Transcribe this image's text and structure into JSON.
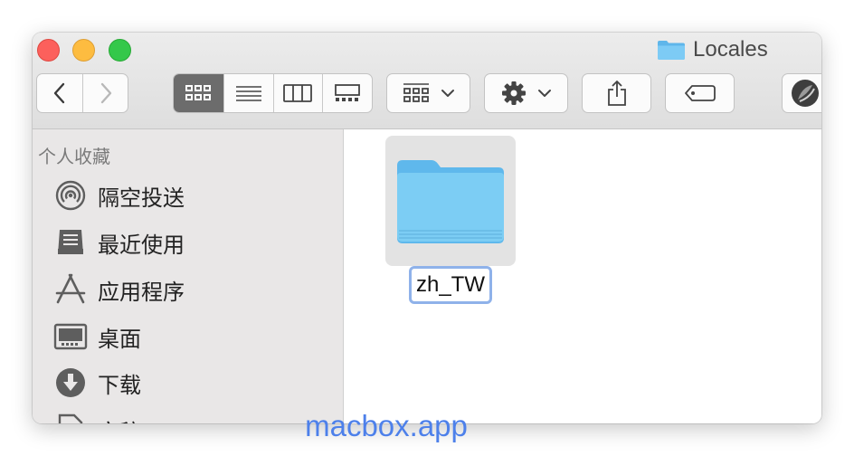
{
  "window": {
    "title": "Locales",
    "title_icon": "folder-icon"
  },
  "toolbar": {
    "back_icon": "chevron-left-icon",
    "forward_icon": "chevron-right-icon",
    "views": [
      "icon-view",
      "list-view",
      "column-view",
      "gallery-view"
    ],
    "active_view": "icon-view",
    "group_icon": "group-grid-icon",
    "action_icon": "gear-icon",
    "share_icon": "share-icon",
    "tags_icon": "tag-icon",
    "extension_icon": "app-extension-icon"
  },
  "sidebar": {
    "heading": "个人收藏",
    "items": [
      {
        "label": "隔空投送",
        "icon": "airdrop-icon"
      },
      {
        "label": "最近使用",
        "icon": "recents-icon"
      },
      {
        "label": "应用程序",
        "icon": "applications-icon"
      },
      {
        "label": "桌面",
        "icon": "desktop-icon"
      },
      {
        "label": "下载",
        "icon": "downloads-icon"
      },
      {
        "label": "文稿",
        "icon": "documents-icon"
      }
    ]
  },
  "content": {
    "items": [
      {
        "name": "zh_TW",
        "kind": "folder",
        "selected": true,
        "renaming": true
      }
    ]
  },
  "colors": {
    "folder": "#7ccdf4",
    "selection": "#8fb2ea",
    "watermark": "#4d80ea"
  },
  "watermark": "macbox.app"
}
